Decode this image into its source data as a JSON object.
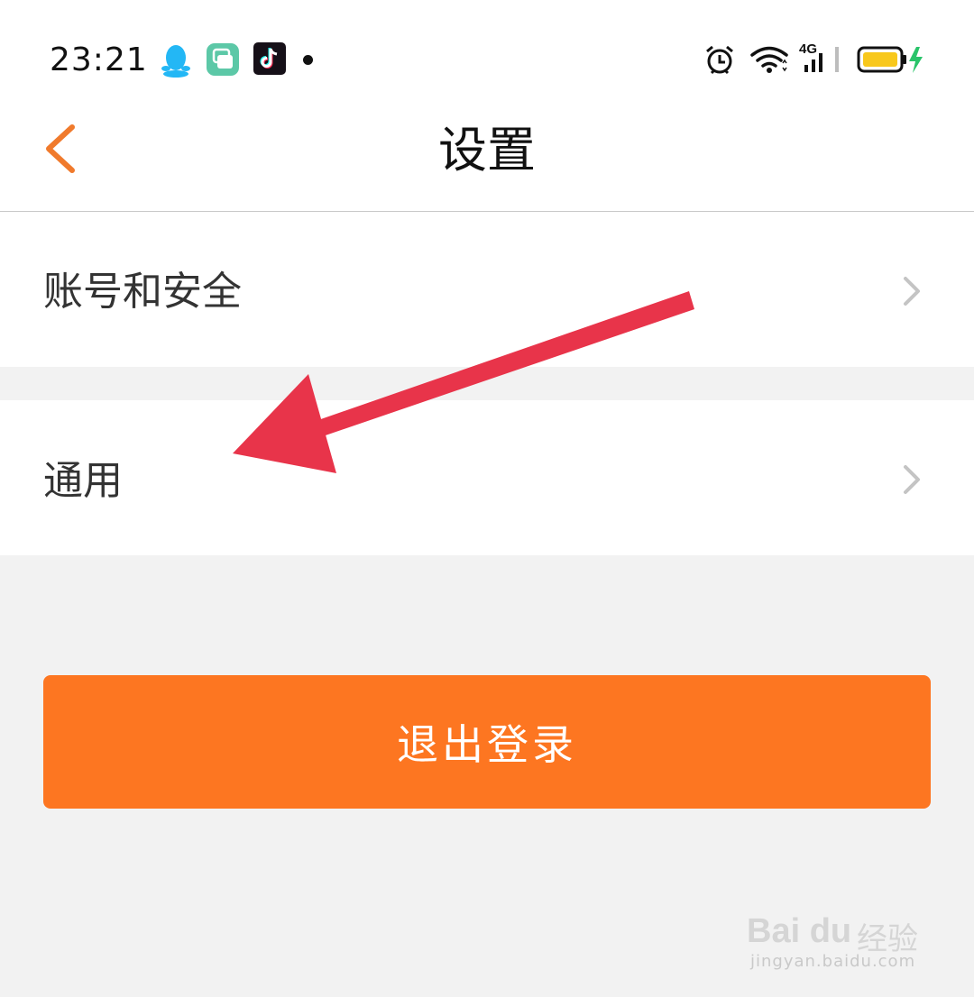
{
  "status_bar": {
    "time": "23:21",
    "network_label": "4G",
    "icons": [
      "qq-icon",
      "cloud-app-icon",
      "tiktok-icon",
      "notification-dot",
      "alarm-icon",
      "wifi-icon",
      "signal-icon",
      "battery-charging-icon"
    ]
  },
  "header": {
    "title": "设置",
    "back_icon": "chevron-left-icon"
  },
  "settings": [
    {
      "label": "账号和安全"
    },
    {
      "label": "通用"
    }
  ],
  "logout_label": "退出登录",
  "watermark": {
    "logo": "Bai du",
    "suffix": "经验",
    "url": "jingyan.baidu.com"
  },
  "colors": {
    "accent": "#fd7621",
    "back_chevron": "#f07a2c",
    "annotation_arrow": "#e8344a",
    "battery_fill": "#f8c81c",
    "charging_bolt": "#29c46a"
  }
}
